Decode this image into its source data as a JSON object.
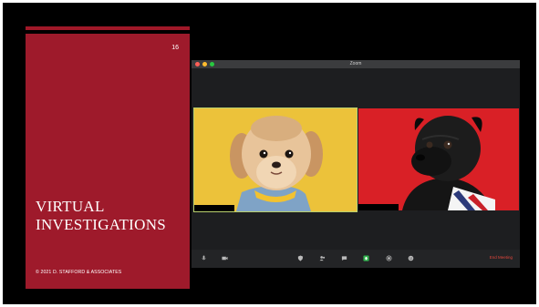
{
  "slide": {
    "number": "16",
    "title_line1": "VIRTUAL",
    "title_line2": "INVESTIGATIONS",
    "copyright": "© 2021 D. STAFFORD & ASSOCIATES"
  },
  "zoom": {
    "window_title": "Zoom",
    "participants": [
      {
        "name": "",
        "description": "shih-tzu-dog",
        "background": "#ecc23a"
      },
      {
        "name": "",
        "description": "black-pug-dog",
        "background": "#d92026"
      }
    ],
    "toolbar": {
      "icons": [
        "microphone-icon",
        "video-camera-icon",
        "security-icon",
        "participants-icon",
        "chat-icon",
        "share-screen-icon",
        "record-icon",
        "reactions-icon"
      ],
      "end_meeting_label": "End Meeting"
    }
  },
  "colors": {
    "accent_red": "#9e1a2b",
    "window_close": "#ff5f57",
    "window_minimize": "#febc2e",
    "window_zoom": "#28c840",
    "share_green": "#2fb24c"
  }
}
